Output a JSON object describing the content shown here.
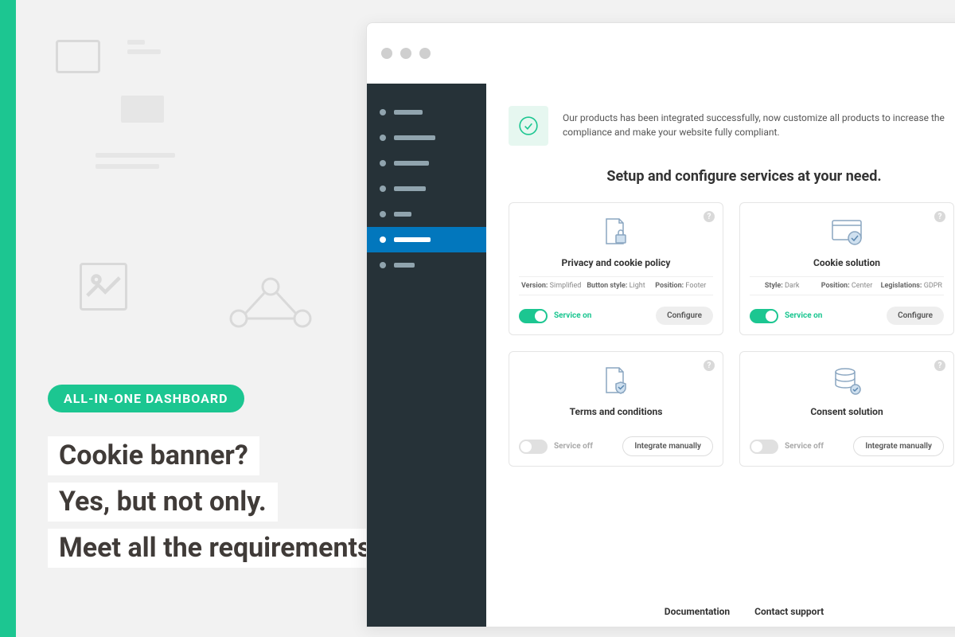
{
  "accent": "#1cc691",
  "tag": "ALL-IN-ONE DASHBOARD",
  "headline1": "Cookie banner?",
  "headline2": "Yes, but not only.",
  "headline3": "Meet all the requirements",
  "notice": "Our products has been integrated successfully, now customize all products to increase the compliance and make your website fully compliant.",
  "setup_title": "Setup and configure services at your need.",
  "cards": [
    {
      "title": "Privacy and cookie policy",
      "meta": [
        {
          "k": "Version",
          "v": "Simplified"
        },
        {
          "k": "Button style",
          "v": "Light"
        },
        {
          "k": "Position",
          "v": "Footer"
        }
      ],
      "service_on": true,
      "service_label": "Service on",
      "btn": "Configure",
      "btn_style": "fill"
    },
    {
      "title": "Cookie solution",
      "meta": [
        {
          "k": "Style",
          "v": "Dark"
        },
        {
          "k": "Position",
          "v": "Center"
        },
        {
          "k": "Legislations",
          "v": "GDPR"
        }
      ],
      "service_on": true,
      "service_label": "Service on",
      "btn": "Configure",
      "btn_style": "fill"
    },
    {
      "title": "Terms and conditions",
      "meta": [],
      "service_on": false,
      "service_label": "Service off",
      "btn": "Integrate manually",
      "btn_style": "outline"
    },
    {
      "title": "Consent solution",
      "meta": [],
      "service_on": false,
      "service_label": "Service off",
      "btn": "Integrate manually",
      "btn_style": "outline"
    }
  ],
  "footer_links": [
    "Documentation",
    "Contact support"
  ],
  "sidebar_items": [
    {
      "w": 36
    },
    {
      "w": 52
    },
    {
      "w": 44
    },
    {
      "w": 40
    },
    {
      "w": 22
    },
    {
      "w": 46,
      "active": true
    },
    {
      "w": 26
    }
  ],
  "icons": {
    "privacy": "document-lock-icon",
    "cookie": "browser-cookie-icon",
    "terms": "document-shield-icon",
    "consent": "database-check-icon"
  }
}
